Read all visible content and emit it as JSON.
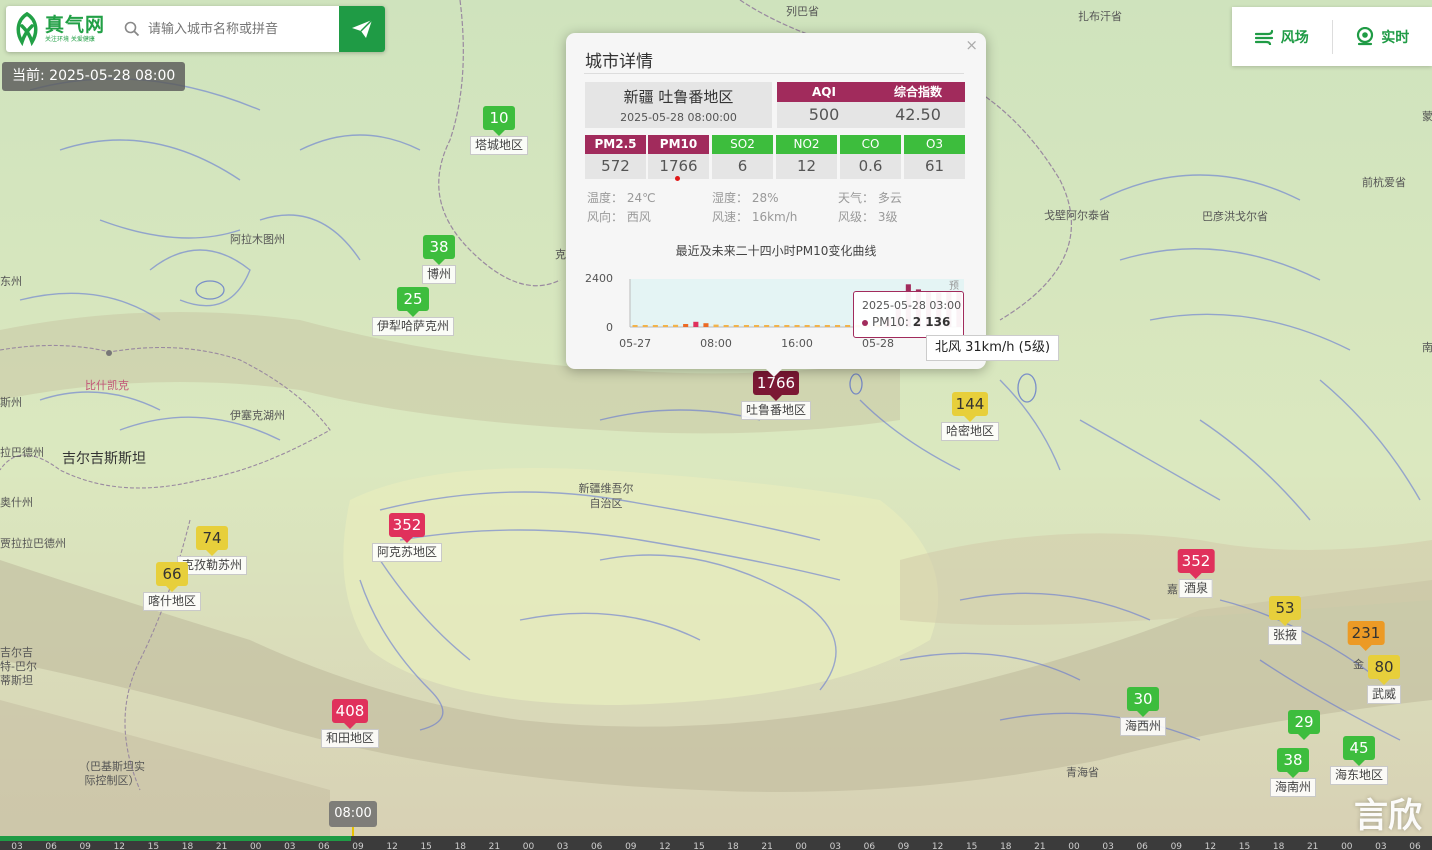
{
  "app": {
    "logo_title": "真气网",
    "logo_slogan": "关注环境  关爱健康",
    "search_placeholder": "请输入城市名称或拼音",
    "current_time": "当前: 2025-05-28 08:00"
  },
  "top_right": {
    "wind_label": "风场",
    "realtime_label": "实时"
  },
  "colors": {
    "brand_green": "#1f9b45",
    "aqi_good": "#3dbd3d",
    "aqi_moderate": "#e7cf3b",
    "aqi_sensitive": "#ec9a25",
    "aqi_unhealthy": "#e0315c",
    "aqi_very_unhealthy": "#a12b5c",
    "aqi_hazardous": "#7b1834"
  },
  "markers": [
    {
      "id": "tacheng",
      "value": "10",
      "city": "塔城地区",
      "level": "green"
    },
    {
      "id": "bozhou",
      "value": "38",
      "city": "博州",
      "level": "green"
    },
    {
      "id": "yili",
      "value": "25",
      "city": "伊犁哈萨克州",
      "level": "green"
    },
    {
      "id": "turpan",
      "value": "1766",
      "city": "吐鲁番地区",
      "level": "maroon"
    },
    {
      "id": "hami",
      "value": "144",
      "city": "哈密地区",
      "level": "yellow"
    },
    {
      "id": "akesu",
      "value": "352",
      "city": "阿克苏地区",
      "level": "red"
    },
    {
      "id": "kezhou",
      "value": "74",
      "city": "克孜勒苏州",
      "level": "yellow"
    },
    {
      "id": "kashi",
      "value": "66",
      "city": "喀什地区",
      "level": "yellow"
    },
    {
      "id": "hetian",
      "value": "408",
      "city": "和田地区",
      "level": "red"
    },
    {
      "id": "jiuquan",
      "value": "352",
      "city": "酒泉",
      "level": "red"
    },
    {
      "id": "zhangye",
      "value": "53",
      "city": "张掖",
      "level": "yellow"
    },
    {
      "id": "jinchang",
      "value": "231",
      "city": "",
      "level": "orange"
    },
    {
      "id": "wuwei",
      "value": "80",
      "city": "武威",
      "level": "yellow"
    },
    {
      "id": "haixi",
      "value": "30",
      "city": "海西州",
      "level": "green"
    },
    {
      "id": "haibei",
      "value": "29",
      "city": "",
      "level": "green"
    },
    {
      "id": "haidong",
      "value": "45",
      "city": "海东地区",
      "level": "green"
    },
    {
      "id": "hainan",
      "value": "38",
      "city": "海南州",
      "level": "green"
    }
  ],
  "map_labels": {
    "liebasheng": "列巴省",
    "buerhan": "扎布汗省",
    "qianhangai": "前杭爱省",
    "gobi_altai": "戈壁阿尔泰省",
    "bayanhongor": "巴彦洪戈尔省",
    "almaty": "阿拉木图州",
    "bishkek": "比什凯克",
    "issyk": "伊塞克湖州",
    "kyrgyz": "吉尔吉斯斯坦",
    "xinjiang": "新疆维吾尔自治区",
    "qinghai": "青海省",
    "pak": "（巴基斯坦实际控制区）",
    "gilgit": "吉尔吉特-巴尔蒂斯坦",
    "left_zhou": "东州",
    "left_zhou2": "斯州",
    "left_talas": "拉巴德州",
    "left_osh": "奥什州",
    "left_jalal": "贾拉拉巴德州",
    "right_frag": "蒙",
    "right_frag2": "南",
    "jia": "嘉",
    "jin": "金",
    "ke": "克"
  },
  "popup": {
    "title": "城市详情",
    "close": "×",
    "city": "新疆 吐鲁番地区",
    "time": "2025-05-28 08:00:00",
    "aqi_label": "AQI",
    "aqi_value": "500",
    "index_label": "综合指数",
    "index_value": "42.50",
    "pollutants": [
      {
        "name": "PM2.5",
        "value": "572",
        "level": "maroon"
      },
      {
        "name": "PM10",
        "value": "1766",
        "level": "maroon"
      },
      {
        "name": "SO2",
        "value": "6",
        "level": "green"
      },
      {
        "name": "NO2",
        "value": "12",
        "level": "green"
      },
      {
        "name": "CO",
        "value": "0.6",
        "level": "green"
      },
      {
        "name": "O3",
        "value": "61",
        "level": "green"
      }
    ],
    "weather": {
      "temp": "温度： 24℃",
      "humidity": "湿度： 28%",
      "sky": "天气： 多云",
      "wind_dir": "风向： 西风",
      "wind_speed": "风速： 16km/h",
      "wind_level": "风级： 3级"
    },
    "chart_title": "最近及未来二十四小时PM10变化曲线",
    "tooltip_time": "2025-05-28 03:00",
    "tooltip_series": "PM10:",
    "tooltip_value": "2 136",
    "wind_tooltip": "北风 31km/h (5级)"
  },
  "chart_data": {
    "type": "bar",
    "title": "最近及未来二十四小时PM10变化曲线",
    "ylim": [
      0,
      2400
    ],
    "y_ticks": [
      "2400",
      "0"
    ],
    "x_ticks": [
      "05-27",
      "08:00",
      "16:00",
      "05-28"
    ],
    "forecast_label": "预",
    "series": [
      {
        "name": "PM10",
        "x": [
          "05-27 00:00",
          "05-27 01:00",
          "05-27 02:00",
          "05-27 03:00",
          "05-27 04:00",
          "05-27 05:00",
          "05-27 06:00",
          "05-27 07:00",
          "05-27 08:00",
          "05-27 09:00",
          "05-27 10:00",
          "05-27 11:00",
          "05-27 12:00",
          "05-27 13:00",
          "05-27 14:00",
          "05-27 15:00",
          "05-27 16:00",
          "05-27 17:00",
          "05-27 18:00",
          "05-27 19:00",
          "05-27 20:00",
          "05-27 21:00",
          "05-27 22:00",
          "05-27 23:00",
          "05-28 00:00",
          "05-28 01:00",
          "05-28 02:00",
          "05-28 03:00",
          "05-28 04:00",
          "05-28 05:00",
          "05-28 06:00",
          "05-28 07:00",
          "05-28 08:00"
        ],
        "values": [
          90,
          80,
          85,
          95,
          110,
          150,
          260,
          190,
          120,
          60,
          70,
          80,
          100,
          90,
          85,
          80,
          90,
          80,
          75,
          70,
          65,
          60,
          60,
          70,
          120,
          420,
          980,
          2136,
          1880,
          1760,
          1720,
          1766,
          1766
        ]
      }
    ]
  },
  "timeline": {
    "current": "08:00",
    "progress": 0.245,
    "ticks": [
      "03",
      "06",
      "09",
      "12",
      "15",
      "18",
      "21",
      "00",
      "03",
      "06",
      "09",
      "12",
      "15",
      "18",
      "21",
      "00",
      "03",
      "06",
      "09",
      "12",
      "15",
      "18",
      "21",
      "00",
      "03",
      "06",
      "09",
      "12",
      "15",
      "18",
      "21",
      "00",
      "03",
      "06",
      "09",
      "12",
      "15",
      "18",
      "21",
      "00",
      "03",
      "06"
    ],
    "watermark": "言欣"
  }
}
